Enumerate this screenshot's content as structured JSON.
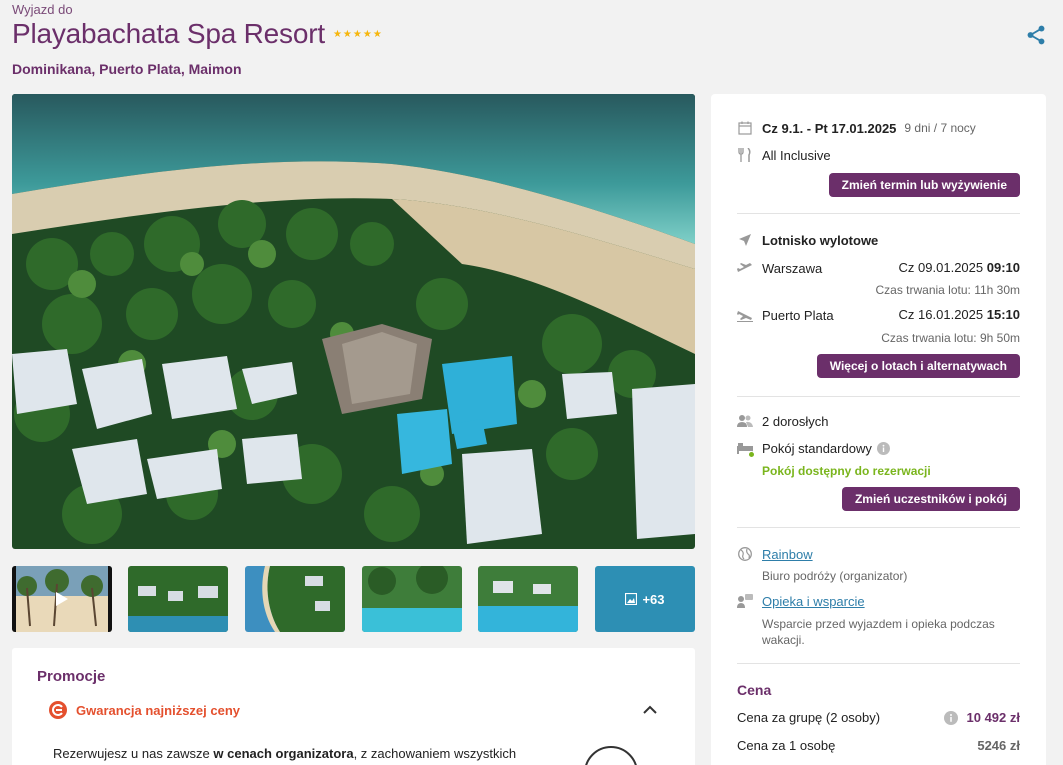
{
  "header": {
    "pre_title": "Wyjazd do",
    "title": "Playabachata Spa Resort",
    "stars": 5,
    "location": "Dominikana, Puerto Plata, Maimon"
  },
  "gallery": {
    "more_label": "+63"
  },
  "promotions": {
    "title": "Promocje",
    "item_label": "Gwarancja najniższej ceny",
    "text_before": "Rezerwujesz u nas zawsze ",
    "text_bold": "w cenach organizatora",
    "text_after": ", z zachowaniem wszystkich"
  },
  "panel": {
    "dates": "Cz 9.1. - Pt 17.01.2025",
    "duration": "9 dni / 7 nocy",
    "board": "All Inclusive",
    "change_date_button": "Zmień termin lub wyżywienie",
    "airport_heading": "Lotnisko wylotowe",
    "outbound": {
      "city": "Warszawa",
      "date": "Cz 09.01.2025",
      "time": "09:10",
      "flight_time": "Czas trwania lotu: 11h 30m"
    },
    "inbound": {
      "city": "Puerto Plata",
      "date": "Cz 16.01.2025",
      "time": "15:10",
      "flight_time": "Czas trwania lotu: 9h 50m"
    },
    "flights_button": "Więcej o lotach i alternatywach",
    "travelers": "2 dorosłych",
    "room": "Pokój standardowy",
    "room_status": "Pokój dostępny do rezerwacji",
    "change_travelers_button": "Zmień uczestników i pokój",
    "organizer_link": "Rainbow",
    "organizer_desc": "Biuro podróży (organizator)",
    "support_link": "Opieka i wsparcie",
    "support_desc": "Wsparcie przed wyjazdem i opieka podczas wakacji.",
    "price_heading": "Cena",
    "group_price_label": "Cena za grupę (2 osoby)",
    "group_price": "10 492 zł",
    "person_price_label": "Cena za 1 osobę",
    "person_price": "5246 zł"
  },
  "colors": {
    "brand": "#6b2f6a",
    "accent_orange": "#e4502e",
    "available_green": "#7ab51d",
    "link_blue": "#2e7ea9",
    "star": "#f6b60d"
  }
}
